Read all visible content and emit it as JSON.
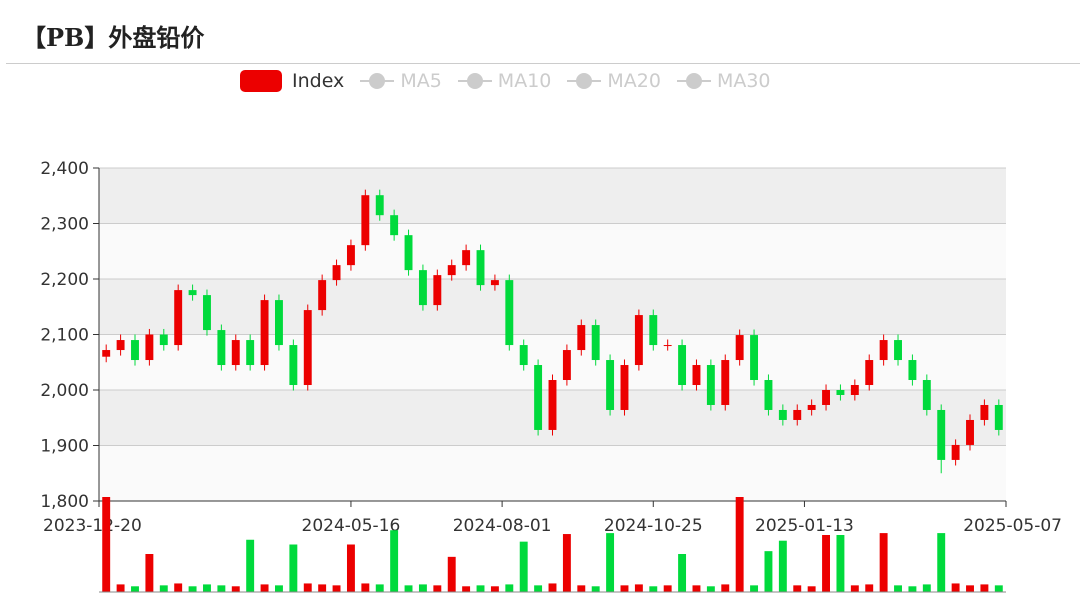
{
  "title": "【PB】外盘铅价",
  "colors": {
    "up": "#ec0000",
    "down": "#00da3c",
    "inactive": "#cccccc"
  },
  "chart_data": {
    "type": "candlestick",
    "title": "【PB】外盘铅价",
    "legend": [
      {
        "name": "Index",
        "active": true
      },
      {
        "name": "MA5",
        "active": false
      },
      {
        "name": "MA10",
        "active": false
      },
      {
        "name": "MA20",
        "active": false
      },
      {
        "name": "MA30",
        "active": false
      }
    ],
    "legend_position": "top-center",
    "ylim": [
      1800,
      2400
    ],
    "yticks": [
      1800,
      1900,
      2000,
      2100,
      2200,
      2300,
      2400
    ],
    "ytick_labels": [
      "1,800",
      "1,900",
      "2,000",
      "2,100",
      "2,200",
      "2,300",
      "2,400"
    ],
    "xtick_labels": [
      {
        "label": "2023-12-20",
        "index": 0
      },
      {
        "label": "2024-05-16",
        "index": 17
      },
      {
        "label": "2024-08-01",
        "index": 27.5
      },
      {
        "label": "2024-10-25",
        "index": 38
      },
      {
        "label": "2025-01-13",
        "index": 48.5
      },
      {
        "label": "2025-05-07",
        "index": 62
      }
    ],
    "candle_fields": [
      "open",
      "close",
      "low",
      "high",
      "volume"
    ],
    "candles": [
      [
        2060,
        2072,
        2050,
        2082,
        100
      ],
      [
        2072,
        2090,
        2062,
        2100,
        8
      ],
      [
        2090,
        2054,
        2044,
        2100,
        6
      ],
      [
        2054,
        2100,
        2044,
        2110,
        40
      ],
      [
        2100,
        2081,
        2071,
        2110,
        7
      ],
      [
        2081,
        2180,
        2071,
        2190,
        9
      ],
      [
        2180,
        2171,
        2161,
        2190,
        6
      ],
      [
        2171,
        2108,
        2098,
        2181,
        8
      ],
      [
        2108,
        2045,
        2035,
        2118,
        7
      ],
      [
        2045,
        2090,
        2035,
        2100,
        6
      ],
      [
        2090,
        2045,
        2035,
        2100,
        55
      ],
      [
        2045,
        2162,
        2035,
        2172,
        8
      ],
      [
        2162,
        2081,
        2071,
        2172,
        7
      ],
      [
        2081,
        2009,
        1999,
        2091,
        50
      ],
      [
        2009,
        2144,
        1999,
        2154,
        9
      ],
      [
        2144,
        2198,
        2134,
        2208,
        8
      ],
      [
        2198,
        2225,
        2188,
        2235,
        7
      ],
      [
        2225,
        2261,
        2215,
        2271,
        50
      ],
      [
        2261,
        2351,
        2251,
        2361,
        9
      ],
      [
        2351,
        2315,
        2305,
        2361,
        8
      ],
      [
        2315,
        2279,
        2269,
        2325,
        65
      ],
      [
        2279,
        2216,
        2206,
        2289,
        7
      ],
      [
        2216,
        2153,
        2143,
        2226,
        8
      ],
      [
        2153,
        2207,
        2143,
        2217,
        7
      ],
      [
        2207,
        2225,
        2197,
        2235,
        37
      ],
      [
        2225,
        2252,
        2215,
        2262,
        6
      ],
      [
        2252,
        2189,
        2179,
        2262,
        7
      ],
      [
        2189,
        2198,
        2179,
        2208,
        6
      ],
      [
        2198,
        2081,
        2071,
        2208,
        8
      ],
      [
        2081,
        2045,
        2035,
        2091,
        53
      ],
      [
        2045,
        1928,
        1918,
        2055,
        7
      ],
      [
        1928,
        2018,
        1918,
        2028,
        9
      ],
      [
        2018,
        2072,
        2008,
        2082,
        61
      ],
      [
        2072,
        2117,
        2062,
        2127,
        7
      ],
      [
        2117,
        2054,
        2044,
        2127,
        6
      ],
      [
        2054,
        1964,
        1954,
        2064,
        62
      ],
      [
        1964,
        2045,
        1954,
        2055,
        7
      ],
      [
        2045,
        2135,
        2035,
        2145,
        8
      ],
      [
        2135,
        2081,
        2071,
        2145,
        6
      ],
      [
        2081,
        2081,
        2071,
        2091,
        7
      ],
      [
        2081,
        2009,
        1999,
        2091,
        40
      ],
      [
        2009,
        2045,
        1999,
        2055,
        7
      ],
      [
        2045,
        1973,
        1963,
        2055,
        6
      ],
      [
        1973,
        2054,
        1963,
        2064,
        8
      ],
      [
        2054,
        2099,
        2044,
        2109,
        100
      ],
      [
        2099,
        2018,
        2008,
        2109,
        7
      ],
      [
        2018,
        1964,
        1954,
        2028,
        43
      ],
      [
        1964,
        1946,
        1936,
        1974,
        54
      ],
      [
        1946,
        1964,
        1936,
        1974,
        7
      ],
      [
        1964,
        1973,
        1954,
        1983,
        6
      ],
      [
        1973,
        2000,
        1963,
        2010,
        60
      ],
      [
        2000,
        1991,
        1981,
        2010,
        60
      ],
      [
        1991,
        2009,
        1981,
        2019,
        7
      ],
      [
        2009,
        2054,
        1999,
        2064,
        8
      ],
      [
        2054,
        2090,
        2044,
        2100,
        62
      ],
      [
        2090,
        2054,
        2044,
        2100,
        7
      ],
      [
        2054,
        2018,
        2008,
        2064,
        6
      ],
      [
        2018,
        1964,
        1954,
        2028,
        8
      ],
      [
        1964,
        1874,
        1850,
        1974,
        62
      ],
      [
        1874,
        1901,
        1864,
        1911,
        9
      ],
      [
        1901,
        1946,
        1891,
        1956,
        7
      ],
      [
        1946,
        1973,
        1936,
        1983,
        8
      ],
      [
        1973,
        1928,
        1918,
        1983,
        7
      ]
    ],
    "volume_max": 100,
    "grid": true
  }
}
